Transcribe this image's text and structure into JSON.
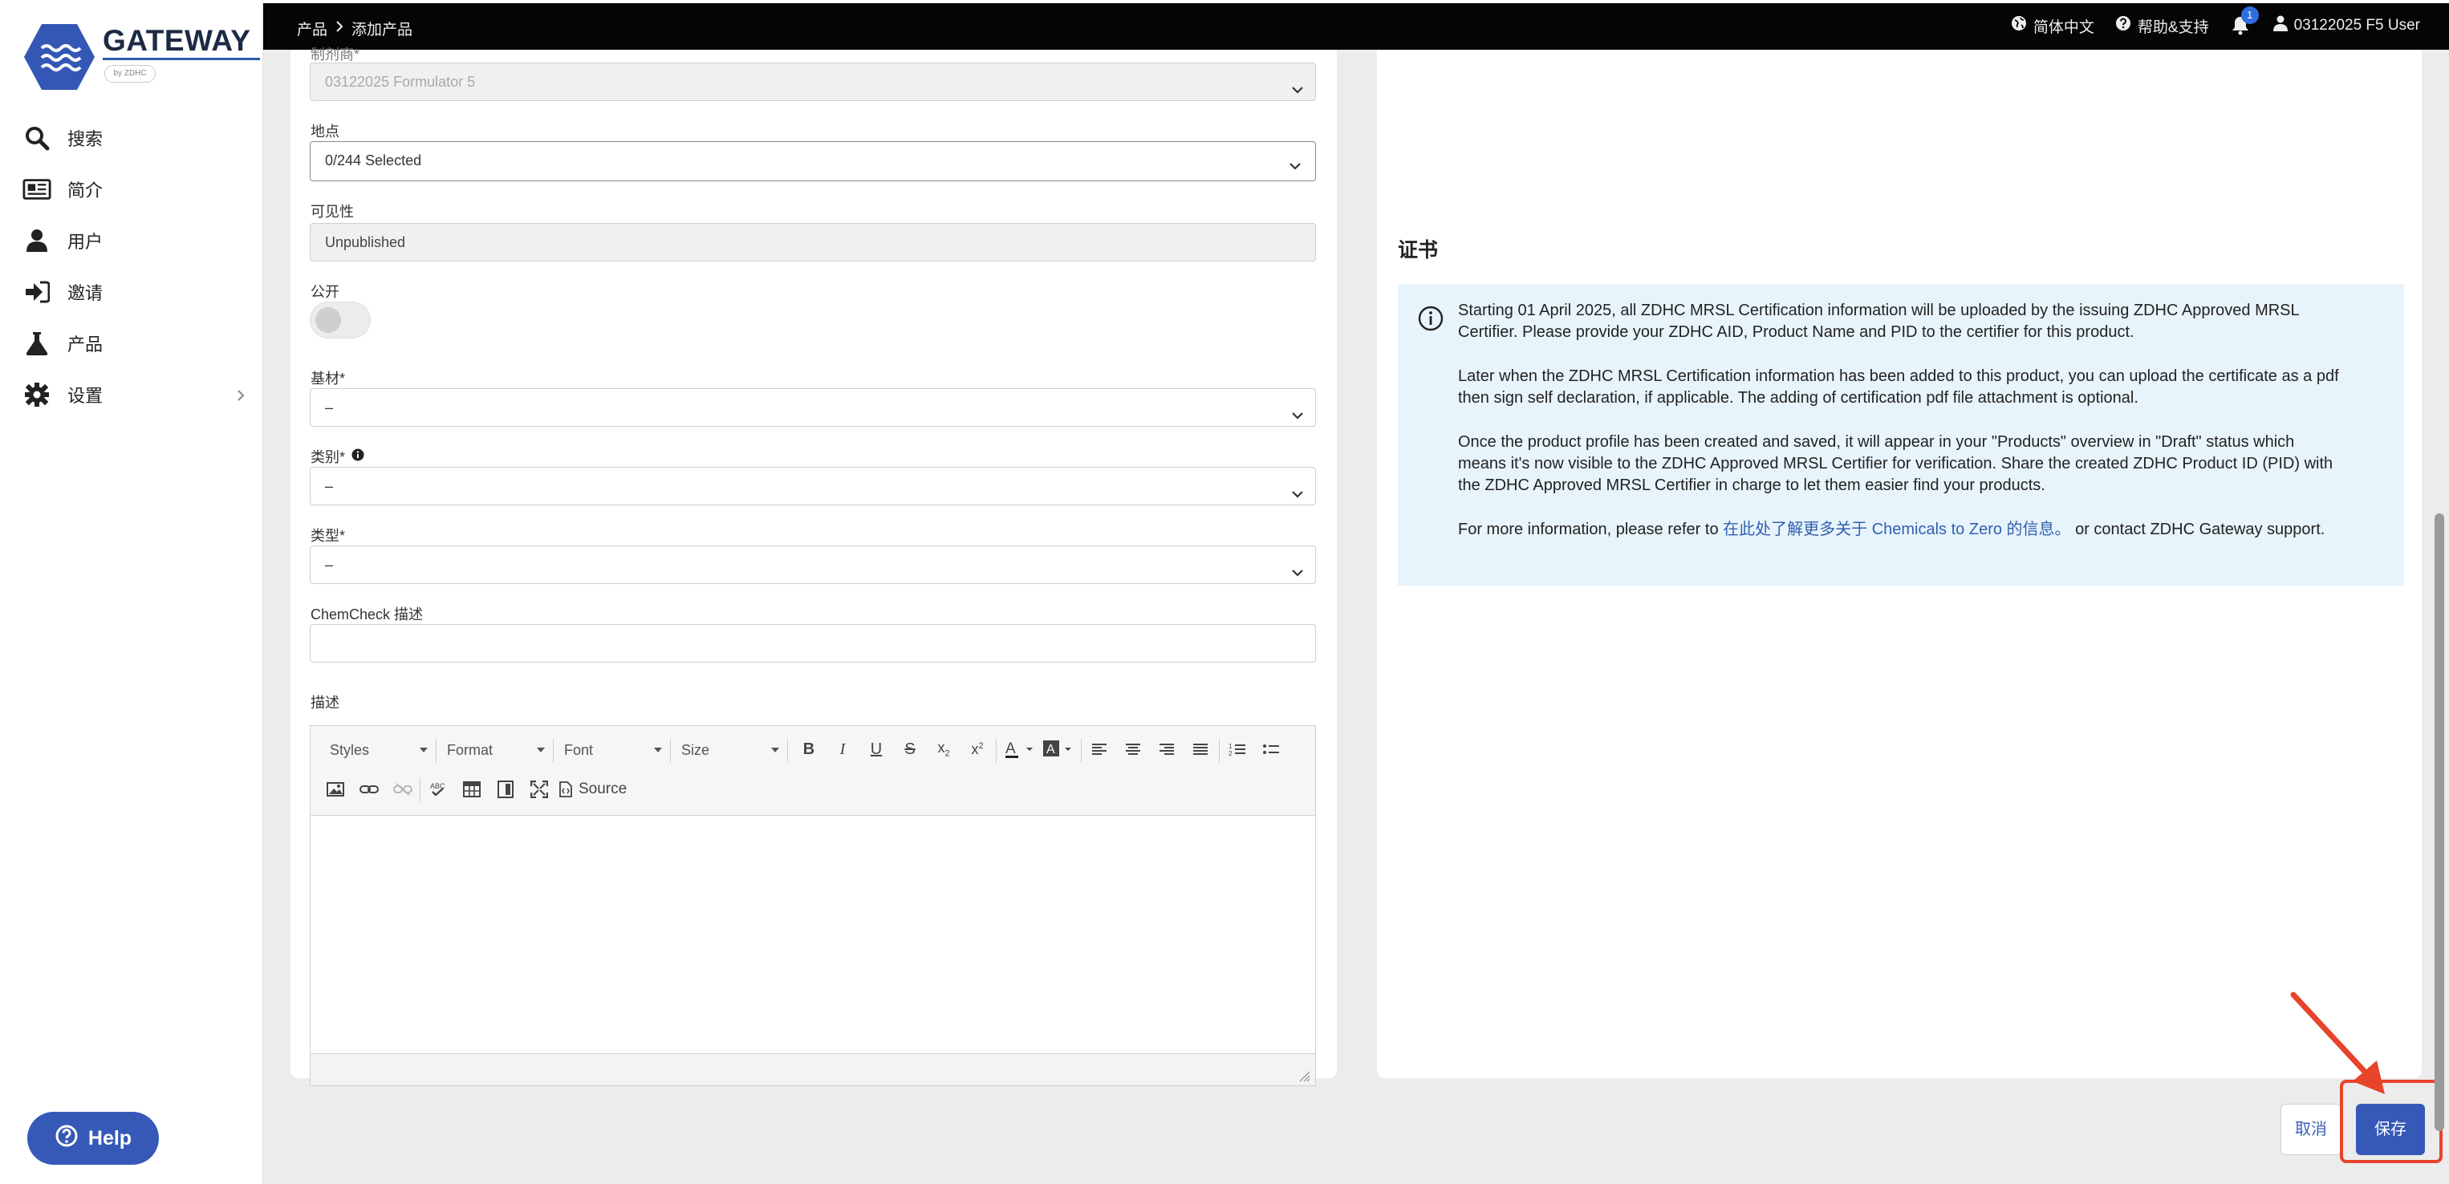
{
  "brand": {
    "name": "GATEWAY",
    "badge": "by ZDHC"
  },
  "sidebar": {
    "items": [
      {
        "label": "搜索",
        "icon": "search-icon"
      },
      {
        "label": "简介",
        "icon": "profile-icon"
      },
      {
        "label": "用户",
        "icon": "user-icon"
      },
      {
        "label": "邀请",
        "icon": "invite-icon"
      },
      {
        "label": "产品",
        "icon": "flask-icon"
      },
      {
        "label": "设置",
        "icon": "gear-icon"
      }
    ],
    "help_label": "Help"
  },
  "topbar": {
    "breadcrumb": [
      "产品",
      "添加产品"
    ],
    "language": "简体中文",
    "help": "帮助&支持",
    "notifications": "1",
    "user": "03122025 F5 User"
  },
  "form": {
    "formulator_label": "制剂商*",
    "formulator_value": "03122025 Formulator 5",
    "location_label": "地点",
    "location_value": "0/244 Selected",
    "visibility_label": "可见性",
    "visibility_value": "Unpublished",
    "public_label": "公开",
    "substrate_label": "基材*",
    "substrate_value": "–",
    "category_label": "类别*",
    "category_value": "–",
    "type_label": "类型*",
    "type_value": "–",
    "chemcheck_label": "ChemCheck 描述",
    "chemcheck_value": "",
    "description_label": "描述"
  },
  "editor": {
    "styles": "Styles",
    "format": "Format",
    "font": "Font",
    "size": "Size",
    "source": "Source"
  },
  "certificate": {
    "title": "证书",
    "p1": "Starting 01 April 2025, all ZDHC MRSL Certification information will be uploaded by the issuing ZDHC Approved MRSL Certifier. Please provide your ZDHC AID, Product Name and PID to the certifier for this product.",
    "p2": "Later when the ZDHC MRSL Certification information has been added to this product, you can upload the certificate as a pdf then sign self declaration, if applicable. The adding of certification pdf file attachment is optional.",
    "p3": "Once the product profile has been created and saved, it will appear in your \"Products\" overview in \"Draft\" status which means it's now visible to the ZDHC Approved MRSL Certifier for verification. Share the created ZDHC Product ID (PID) with the ZDHC Approved MRSL Certifier in charge to let them easier find your products.",
    "p4_prefix": "For more information, please refer to ",
    "p4_link": "在此处了解更多关于 Chemicals to Zero 的信息。",
    "p4_suffix": " or contact ZDHC Gateway support."
  },
  "actions": {
    "cancel": "取消",
    "save": "保存"
  },
  "colors": {
    "primary": "#3659b8",
    "highlight": "#e8432b",
    "info_bg": "#e8f4fb"
  }
}
